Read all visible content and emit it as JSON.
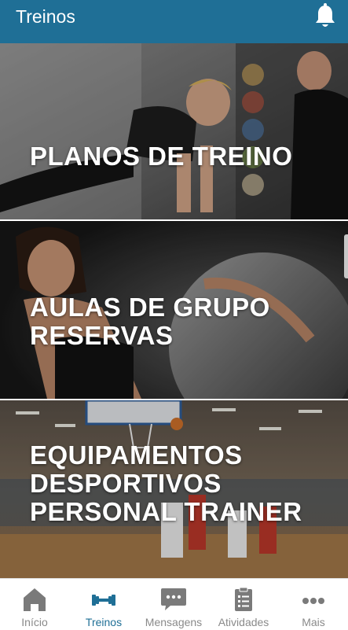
{
  "header": {
    "title": "Treinos"
  },
  "cards": [
    {
      "lines": [
        "PLANOS DE TREINO"
      ]
    },
    {
      "lines": [
        "AULAS DE GRUPO",
        "RESERVAS"
      ]
    },
    {
      "lines": [
        "EQUIPAMENTOS",
        "DESPORTIVOS",
        "PERSONAL TRAINER"
      ]
    }
  ],
  "tabs": [
    {
      "label": "Início",
      "icon": "home-icon",
      "active": false
    },
    {
      "label": "Treinos",
      "icon": "dumbbell-icon",
      "active": true
    },
    {
      "label": "Mensagens",
      "icon": "chat-icon",
      "active": false
    },
    {
      "label": "Atividades",
      "icon": "clipboard-icon",
      "active": false
    },
    {
      "label": "Mais",
      "icon": "more-icon",
      "active": false
    }
  ],
  "colors": {
    "header_bg": "#1f6f96",
    "tab_active": "#1f6f96",
    "tab_inactive": "#8a8a8a"
  }
}
